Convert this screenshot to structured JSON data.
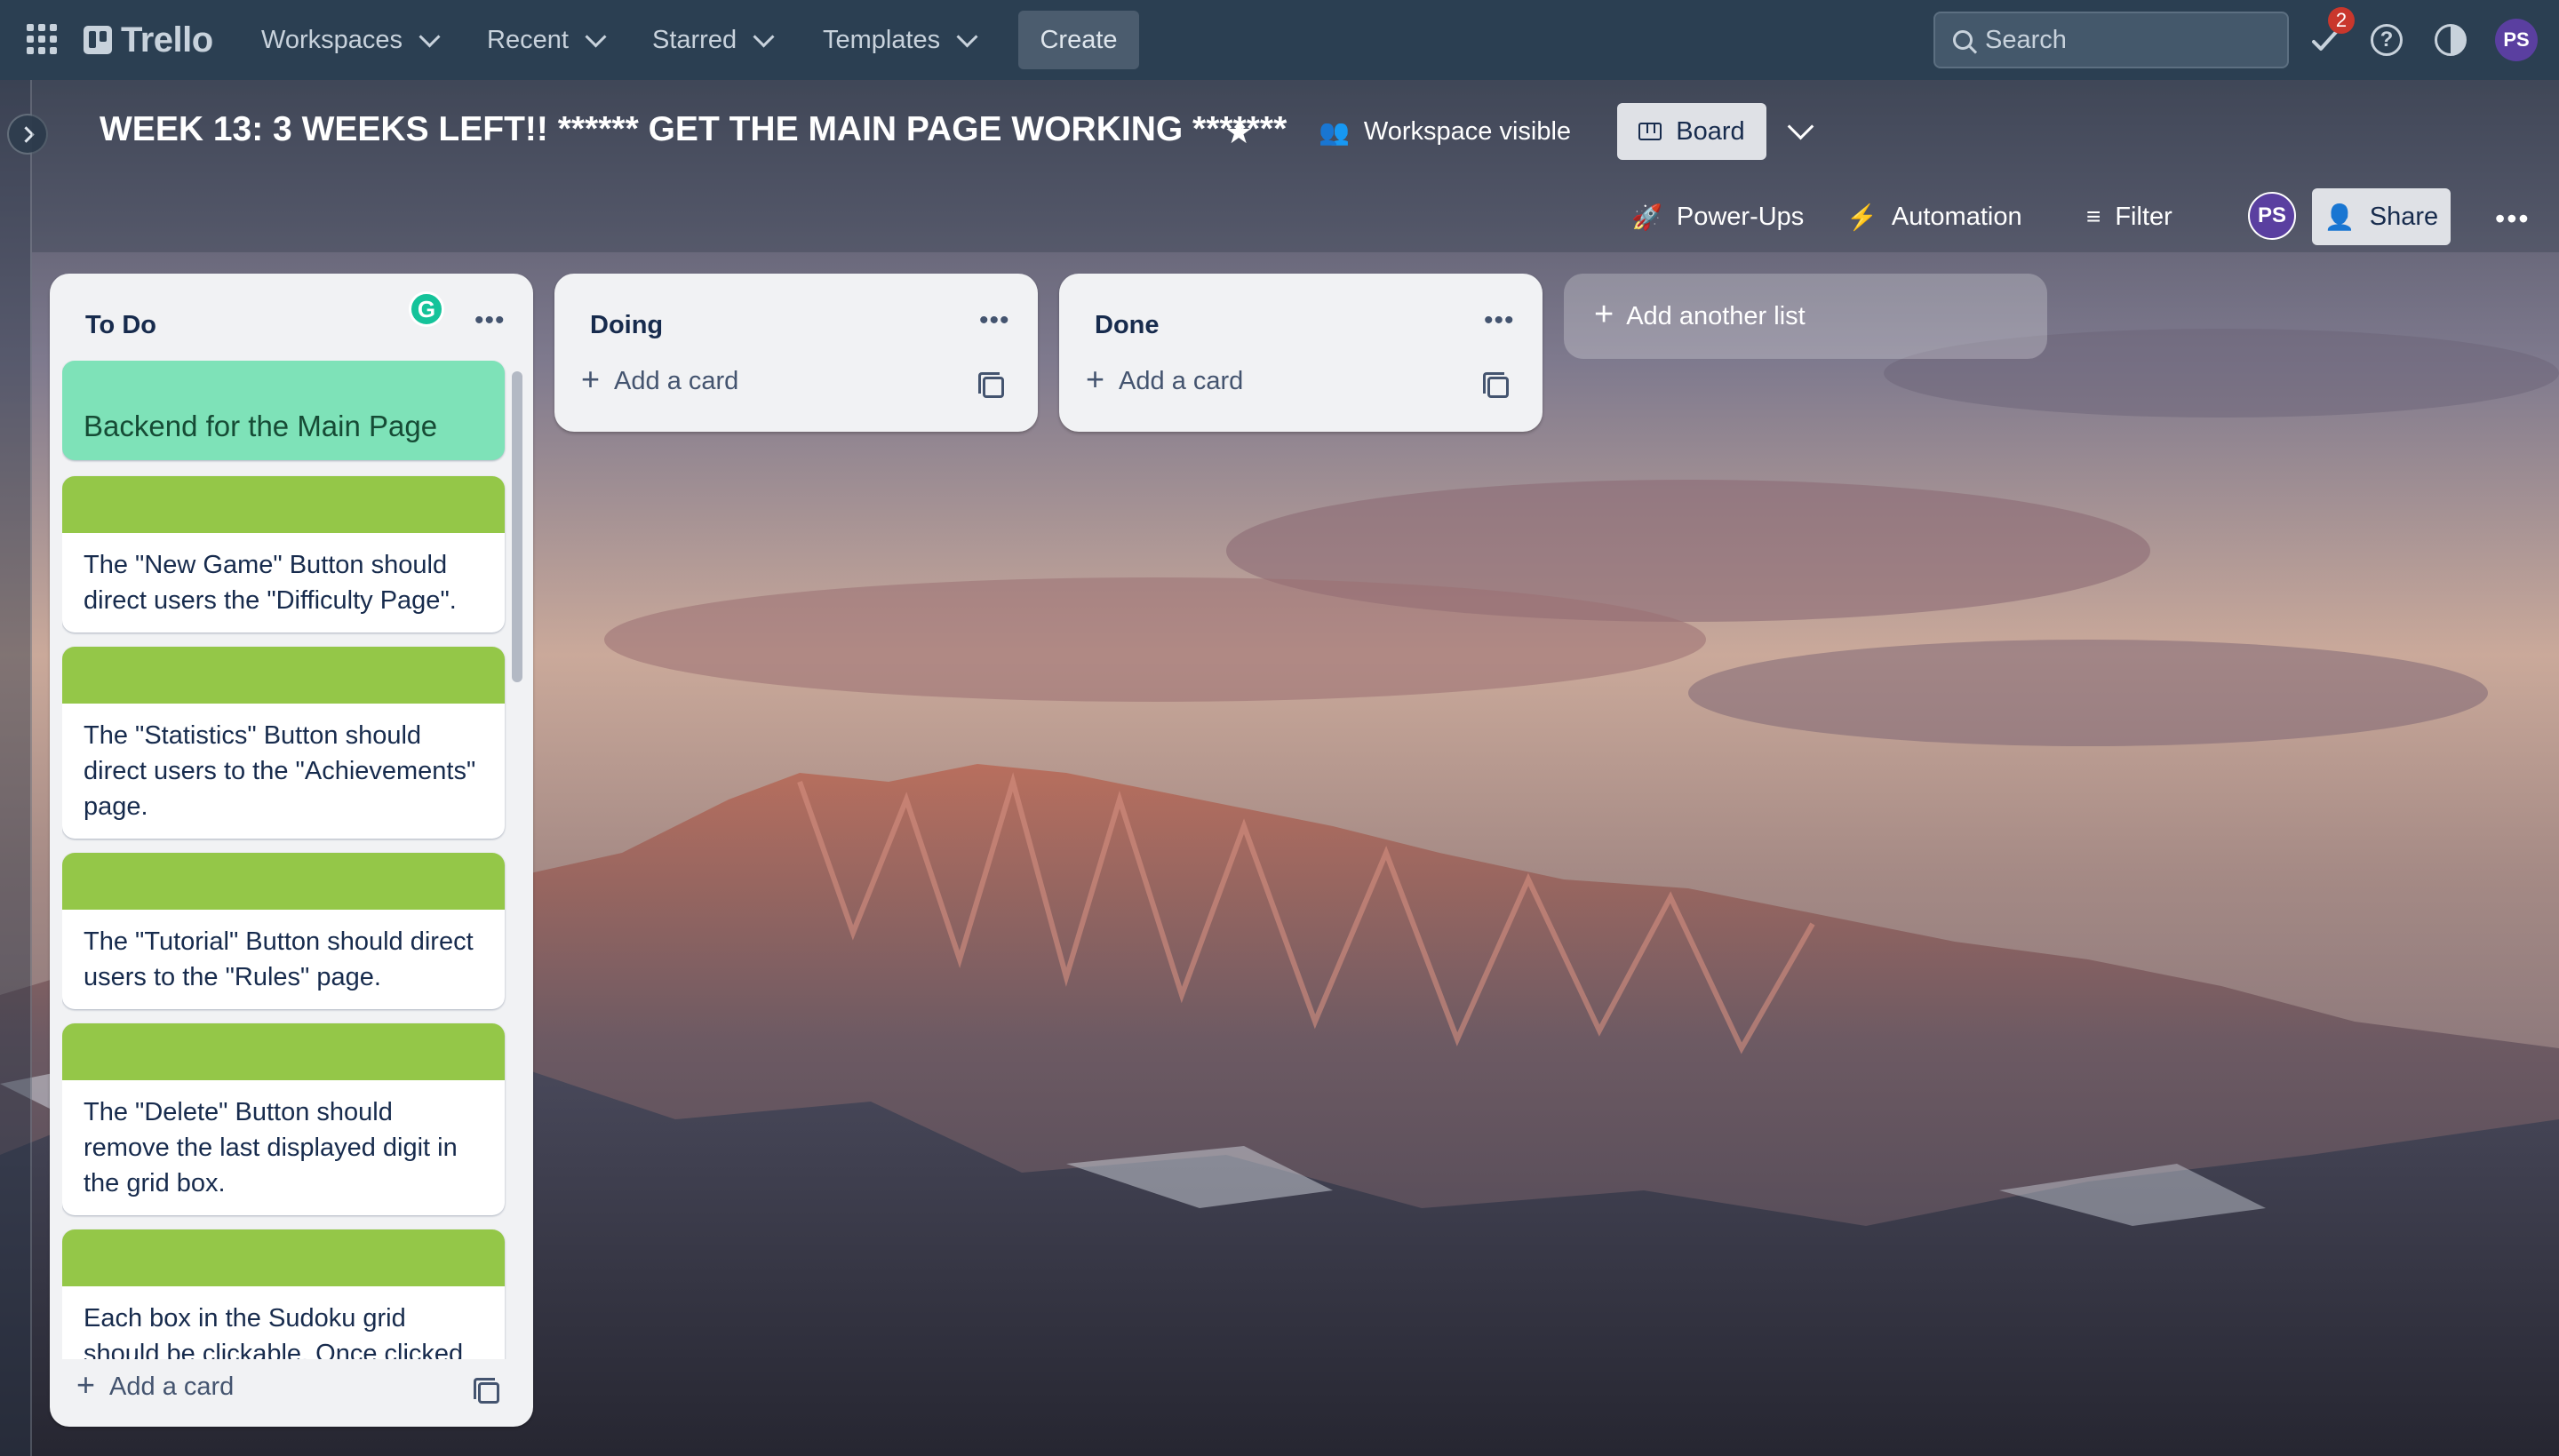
{
  "topnav": {
    "logo": "Trello",
    "menus": [
      "Workspaces",
      "Recent",
      "Starred",
      "Templates"
    ],
    "create_label": "Create",
    "search_placeholder": "Search",
    "notification_count": "2",
    "user_initials": "PS"
  },
  "board": {
    "title": "WEEK 13: 3 WEEKS LEFT!! ****** GET THE MAIN PAGE WORKING *******",
    "visibility": "Workspace visible",
    "view_label": "Board",
    "powerups_label": "Power-Ups",
    "automation_label": "Automation",
    "filter_label": "Filter",
    "member_initials": "PS",
    "share_label": "Share"
  },
  "lists": [
    {
      "title": "To Do",
      "add_card_label": "Add a card",
      "cards": [
        "Backend for the Main Page",
        "The \"New Game\" Button should direct users the \"Difficulty Page\".",
        "The \"Statistics\" Button should direct users to the \"Achievements\" page.",
        "The \"Tutorial\" Button should direct users to the \"Rules\" page.",
        "The \"Delete\" Button should remove the last displayed digit in the grid box.",
        "Each box in the Sudoku grid should be clickable. Once clicked the user"
      ]
    },
    {
      "title": "Doing",
      "add_card_label": "Add a card",
      "cards": []
    },
    {
      "title": "Done",
      "add_card_label": "Add a card",
      "cards": []
    }
  ],
  "add_list_label": "Add another list",
  "colors": {
    "nav_bg": "#2b3f52",
    "list_bg": "#f1f2f4",
    "card_cover_green": "#94c748",
    "card_green_bg": "#7ee2b8",
    "badge_red": "#c9372c",
    "avatar_purple": "#5a3fa0"
  }
}
